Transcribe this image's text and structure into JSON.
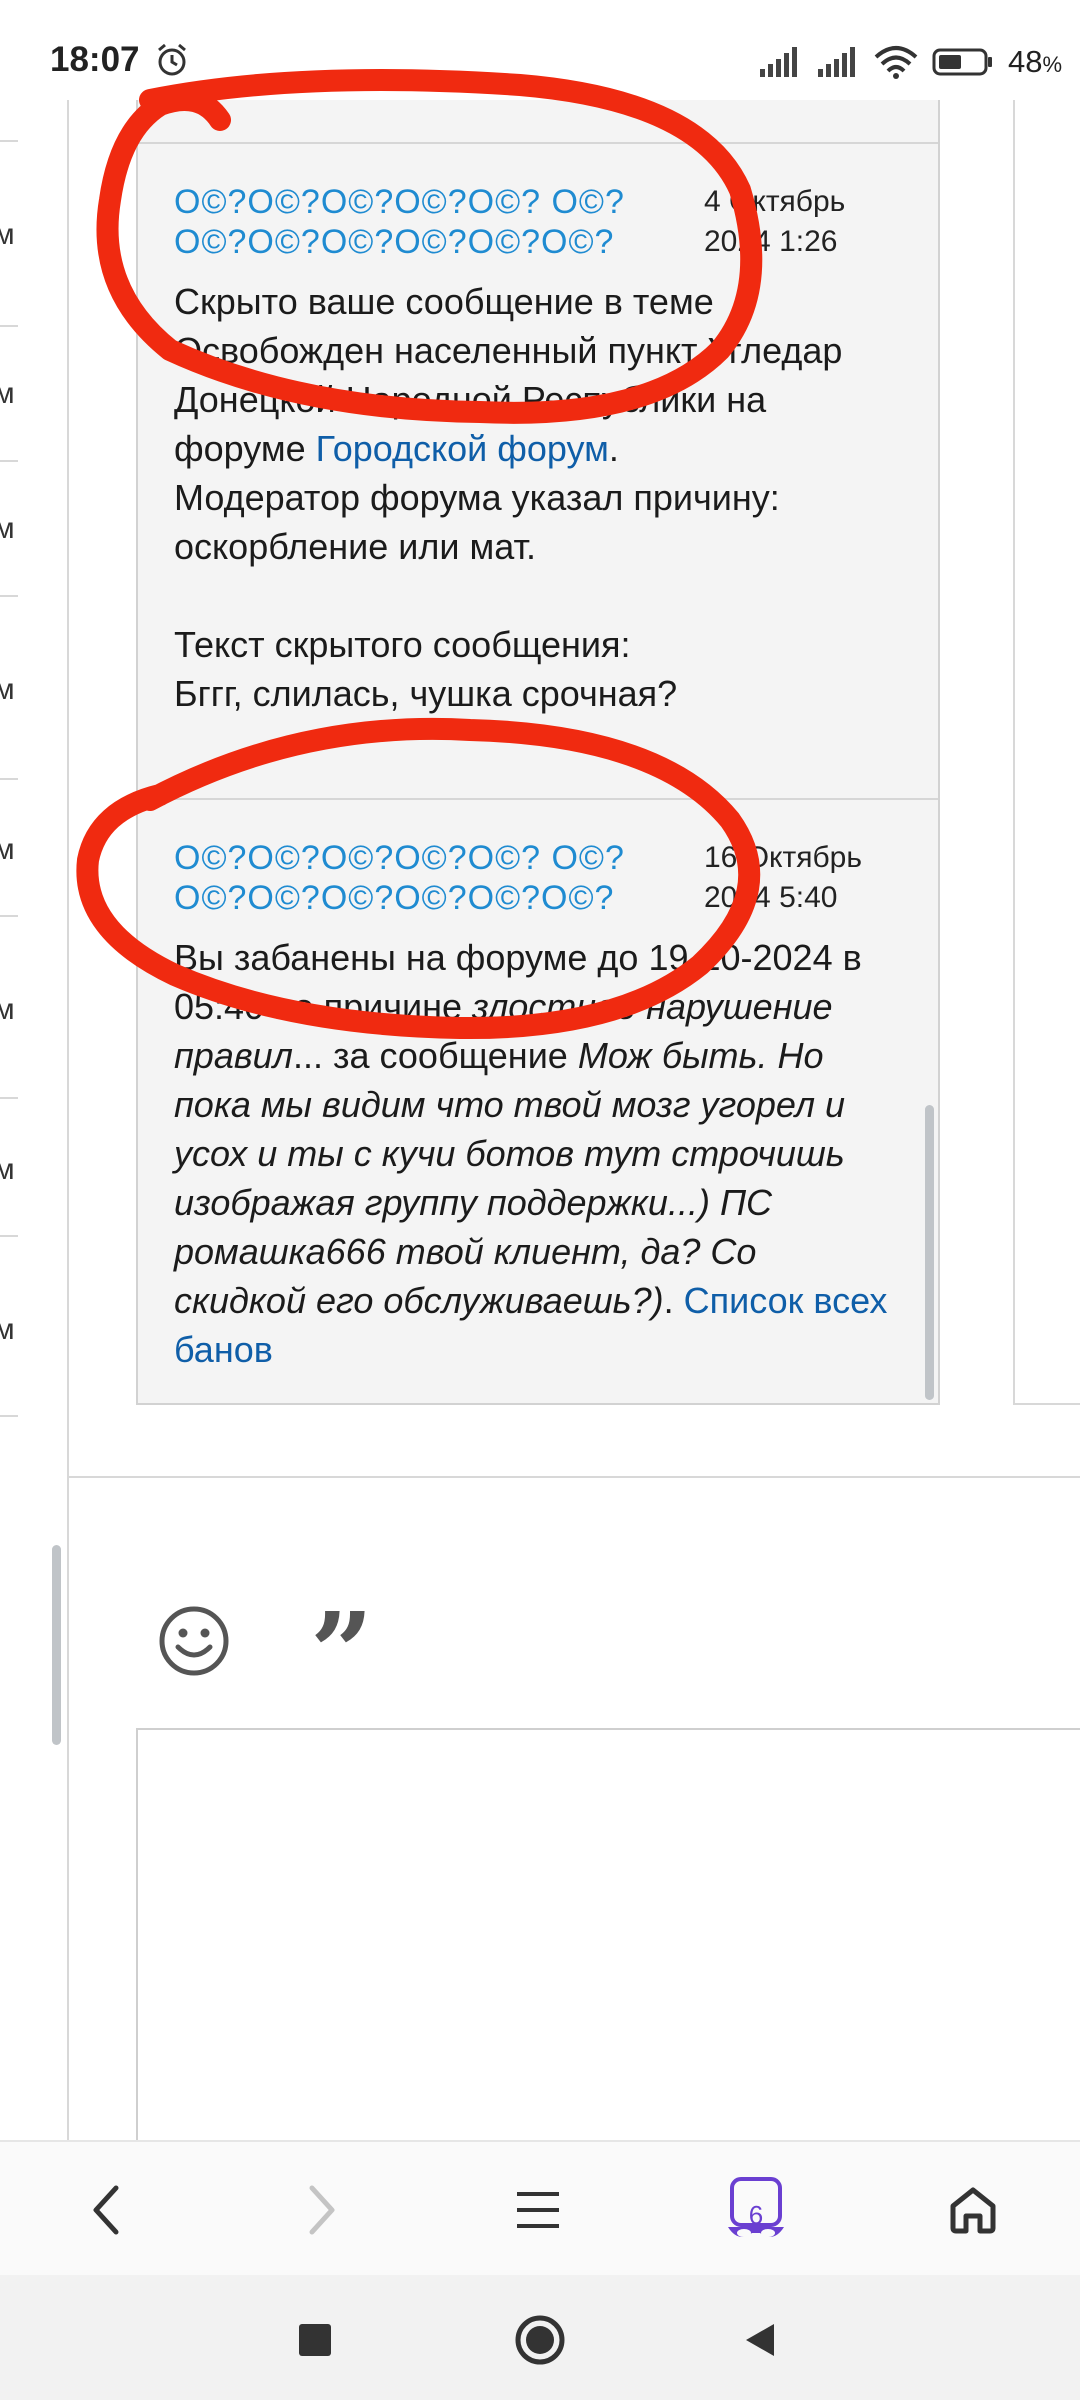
{
  "status_bar": {
    "time": "18:07",
    "battery_percent": "48",
    "battery_suffix": "%"
  },
  "sidebar": {
    "items": [
      {
        "letter": "м"
      },
      {
        "letter": "м"
      },
      {
        "letter": "м"
      },
      {
        "letter": "м"
      },
      {
        "letter": "м"
      },
      {
        "letter": "м"
      },
      {
        "letter": "м"
      },
      {
        "letter": "м"
      }
    ]
  },
  "messages": [
    {
      "sender_line1": "О©?О©?О©?О©?О©? О©?",
      "sender_line2": "О©?О©?О©?О©?О©?О©?",
      "date_line1": "4 Октябрь",
      "date_line2": "2024 1:26",
      "body_part1": "Скрыто ваше сообщение в теме Освобожден населенный пункт Угледар Донецкой Народной Республики на форуме ",
      "body_link": "Городской форум",
      "body_part2": ".",
      "body_part3": "Модератор форума указал причину: оскорбление или мат.",
      "body_part4": "Текст скрытого сообщения:",
      "body_part5": "Бггг, слилась, чушка срочная?"
    },
    {
      "sender_line1": "О©?О©?О©?О©?О©? О©?",
      "sender_line2": "О©?О©?О©?О©?О©?О©?",
      "date_line1": "16 Октябрь",
      "date_line2": "2024 5:40",
      "body_part1": "Вы забанены на форуме до 19-10-2024 в 05:40 по причине ",
      "body_italic1": "злостное нарушение правил",
      "body_part2": "... за сообщение ",
      "body_italic2": "Мож быть. Но пока мы видим что твой мозг угорел и усох и ты с кучи ботов тут строчишь изображая группу поддержки...) ПС ромашка666 твой клиент, да? Со скидкой его обслуживаешь?)",
      "body_part3": ". ",
      "body_link": "Список всех банов"
    }
  ],
  "composer": {
    "emoji_icon": "smiley-icon",
    "quote_icon": "quote-icon",
    "quote_glyph": "”"
  },
  "browser_bar": {
    "tabs_count": "6"
  },
  "colors": {
    "sender": "#1f8bd1",
    "link": "#0f5ea8",
    "panel_bg": "#f4f4f4",
    "annotation_red": "#f02a10",
    "tabs_accent": "#6a3fd1"
  }
}
